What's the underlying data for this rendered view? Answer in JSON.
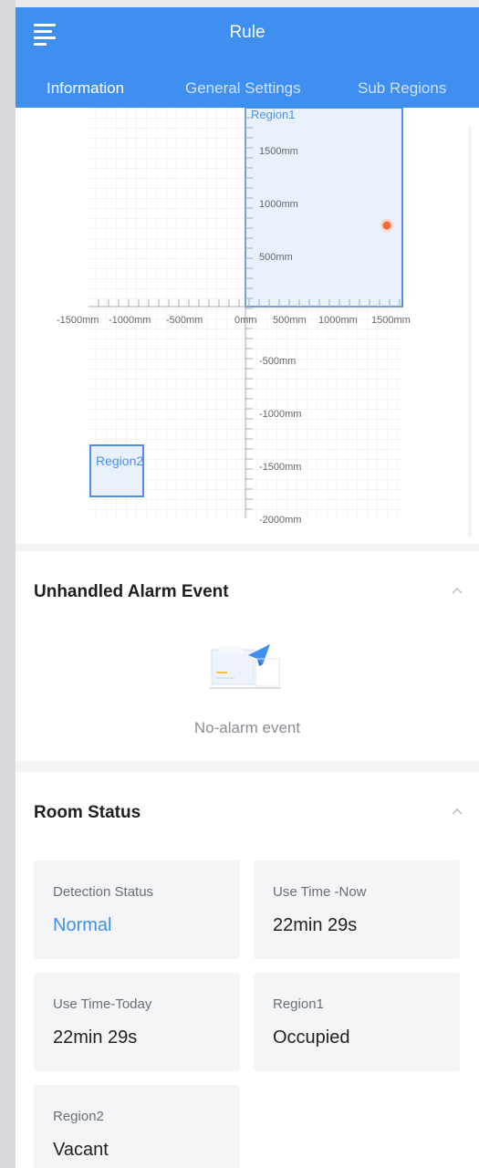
{
  "header": {
    "title": "Rule",
    "tabs": [
      {
        "label": "Information",
        "active": true
      },
      {
        "label": "General Settings",
        "active": false
      },
      {
        "label": "Sub Regions",
        "active": false
      }
    ]
  },
  "map": {
    "region1_label": "Region1",
    "region2_label": "Region2",
    "x_ticks": [
      "-1500mm",
      "-1000mm",
      "-500mm",
      "0mm",
      "500mm",
      "1000mm",
      "1500mm"
    ],
    "y_ticks": [
      "1500mm",
      "1000mm",
      "500mm",
      "-500mm",
      "-1000mm",
      "-1500mm",
      "-2000mm"
    ],
    "target_point_color": "#f26b3a"
  },
  "alarm": {
    "title": "Unhandled Alarm Event",
    "empty_text": "No-alarm event"
  },
  "room_status": {
    "title": "Room Status",
    "tiles": [
      {
        "label": "Detection Status",
        "value": "Normal"
      },
      {
        "label": "Use Time -Now",
        "value": "22min 29s"
      },
      {
        "label": "Use Time-Today",
        "value": "22min 29s"
      },
      {
        "label": "Region1",
        "value": "Occupied"
      },
      {
        "label": "Region2",
        "value": "Vacant"
      }
    ]
  },
  "colors": {
    "accent": "#3f8ff1",
    "active_tab_indicator": "#f3d36b"
  }
}
